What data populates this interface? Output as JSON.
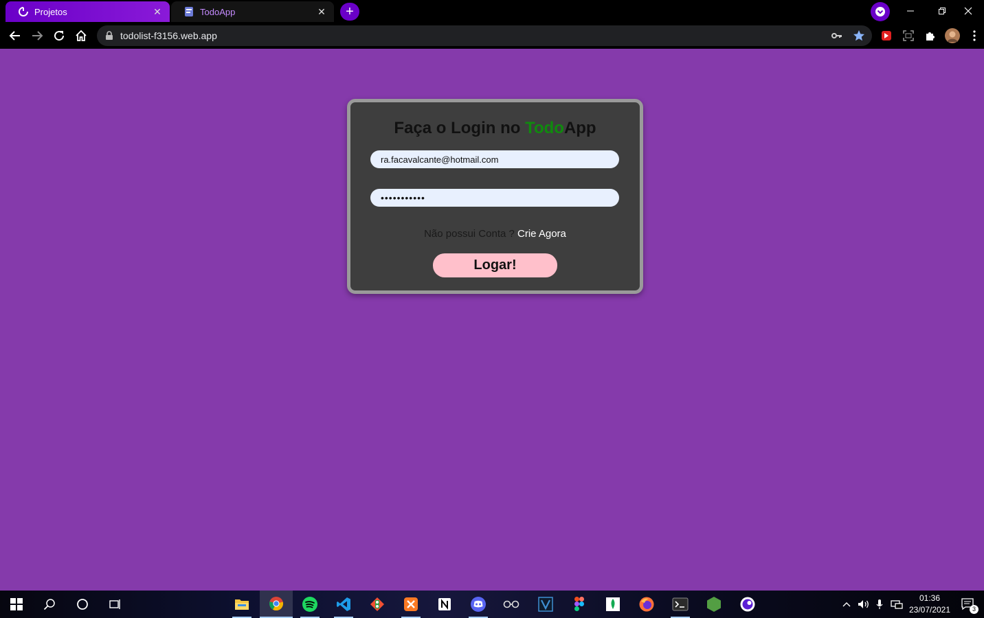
{
  "browser": {
    "tabs": [
      {
        "label": "Projetos",
        "active": false
      },
      {
        "label": "TodoApp",
        "active": true
      }
    ],
    "new_tab_label": "+",
    "address": "todolist-f3156.web.app"
  },
  "login": {
    "title_prefix": "Faça o Login no ",
    "title_accent": "Todo",
    "title_suffix": "App",
    "email_value": "ra.facavalcante@hotmail.com",
    "password_value": "•••••••••••",
    "signup_prompt": "Não possui Conta ?",
    "signup_link": "Crie Agora",
    "submit_label": "Logar!"
  },
  "taskbar": {
    "time": "01:36",
    "date": "23/07/2021",
    "notification_count": "3"
  },
  "colors": {
    "page_background": "#853aab",
    "card_background": "#3e3e3e",
    "card_border": "#9a9a9a",
    "title_accent": "#108a0e",
    "button_background": "#ffc0cb",
    "input_background": "#e8f0fe",
    "tab_accent": "#6a00c8"
  },
  "icons": {
    "tabs": [
      "loading-spinner-icon",
      "todoapp-favicon"
    ],
    "toolbar": [
      "back-icon",
      "forward-icon",
      "reload-icon",
      "home-icon",
      "lock-icon",
      "key-icon",
      "star-icon",
      "extension-red-icon",
      "screenshot-icon",
      "puzzle-icon",
      "avatar",
      "kebab-menu-icon"
    ],
    "taskbar": [
      "windows-start-icon",
      "search-icon",
      "cortana-icon",
      "task-view-icon",
      "file-explorer-icon",
      "chrome-icon",
      "spotify-icon",
      "vscode-icon",
      "git-icon",
      "xampp-icon",
      "notion-icon",
      "discord-icon",
      "glasses-icon",
      "vue-icon",
      "figma-icon",
      "mongodb-icon",
      "firefox-icon",
      "terminal-icon",
      "nodejs-icon",
      "app-circle-icon"
    ]
  }
}
